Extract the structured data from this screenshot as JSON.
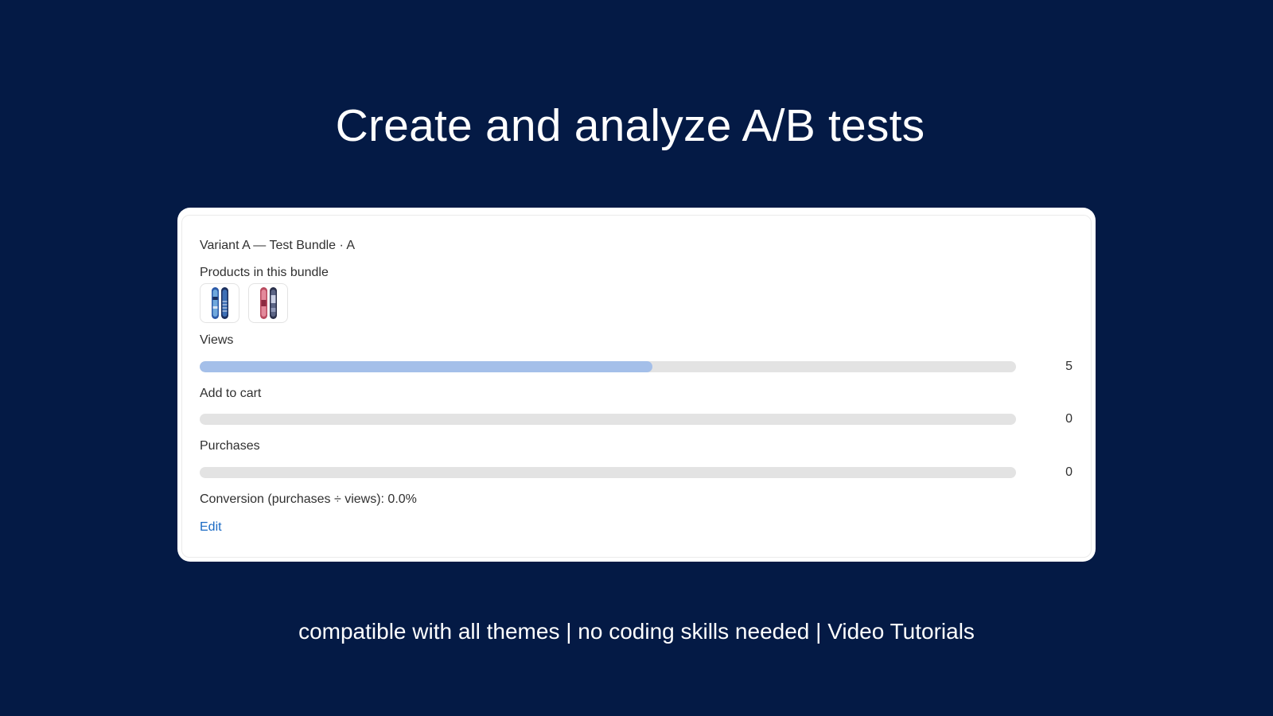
{
  "headline": "Create and analyze A/B tests",
  "card": {
    "variant_title": "Variant A — Test Bundle · A",
    "products_label": "Products in this bundle",
    "products": [
      {
        "icon": "snowboard-blue-icon"
      },
      {
        "icon": "snowboard-red-icon"
      }
    ],
    "metrics": [
      {
        "label": "Views",
        "value": "5",
        "fill": 0.555,
        "fill_color": "#a4bfe9"
      },
      {
        "label": "Add to cart",
        "value": "0",
        "fill": 0
      },
      {
        "label": "Purchases",
        "value": "0",
        "fill": 0
      }
    ],
    "conversion": "Conversion (purchases ÷ views): 0.0%",
    "edit_label": "Edit",
    "edit_color": "#1a6ac4"
  },
  "tagline": "compatible with all themes | no coding skills needed | Video Tutorials",
  "colors": {
    "background": "#041a45",
    "card": "#ffffff",
    "track": "#e3e3e3"
  }
}
